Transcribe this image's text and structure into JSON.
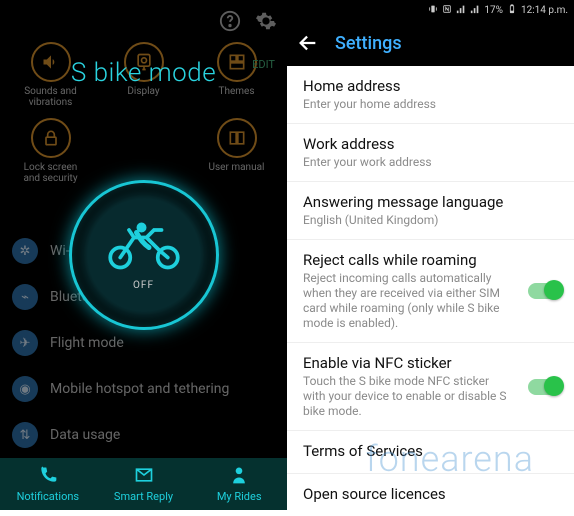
{
  "left": {
    "statusEdit": "EDIT",
    "title": "S bike mode",
    "bigButtonState": "OFF",
    "quick": [
      {
        "label": "Sounds and vibrations",
        "icon": "sound-icon"
      },
      {
        "label": "Display",
        "icon": "display-icon"
      },
      {
        "label": "Themes",
        "icon": "themes-icon"
      },
      {
        "label": "Lock screen and security",
        "icon": "lock-icon"
      },
      {
        "label": "User manual",
        "icon": "manual-icon"
      }
    ],
    "list": [
      {
        "label": "Wi-Fi",
        "icon": "wifi-icon"
      },
      {
        "label": "Bluetooth",
        "icon": "bluetooth-icon"
      },
      {
        "label": "Flight mode",
        "icon": "airplane-icon"
      },
      {
        "label": "Mobile hotspot and tethering",
        "icon": "hotspot-icon"
      },
      {
        "label": "Data usage",
        "icon": "data-icon"
      }
    ],
    "tabs": [
      {
        "label": "Notifications",
        "icon": "phone-icon"
      },
      {
        "label": "Smart Reply",
        "icon": "envelope-icon"
      },
      {
        "label": "My Rides",
        "icon": "rider-icon"
      }
    ]
  },
  "right": {
    "status": {
      "battery": "17%",
      "time": "12:14 p.m."
    },
    "headerTitle": "Settings",
    "items": [
      {
        "title": "Home address",
        "sub": "Enter your home address",
        "toggle": false
      },
      {
        "title": "Work address",
        "sub": "Enter your work address",
        "toggle": false
      },
      {
        "title": "Answering message language",
        "sub": "English (United Kingdom)",
        "toggle": false
      },
      {
        "title": "Reject calls while roaming",
        "sub": "Reject incoming calls automatically when they are received via either SIM card while roaming (only while S bike mode is enabled).",
        "toggle": true
      },
      {
        "title": "Enable via NFC sticker",
        "sub": "Touch the S bike mode NFC sticker with your device to enable or disable S bike mode.",
        "toggle": true
      },
      {
        "title": "Terms of Services",
        "sub": "",
        "toggle": false
      },
      {
        "title": "Open source licences",
        "sub": "",
        "toggle": false
      }
    ]
  },
  "watermark": "fonearena"
}
